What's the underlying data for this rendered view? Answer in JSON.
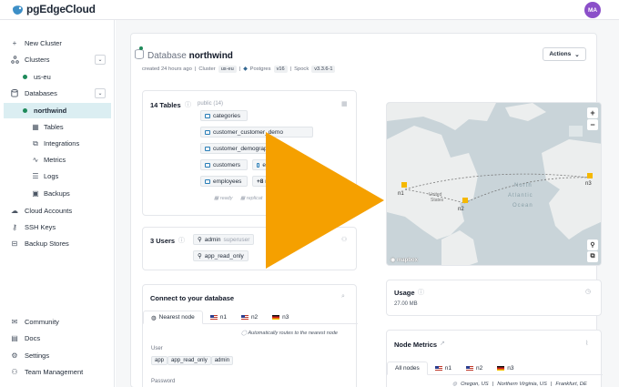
{
  "brand": {
    "name": "pgEdgeCloud"
  },
  "user": {
    "initials": "MA"
  },
  "sidebar": {
    "new_cluster": "New Cluster",
    "clusters": "Clusters",
    "cluster_item": "us-eu",
    "databases": "Databases",
    "database_item": "northwind",
    "sub": [
      "Tables",
      "Integrations",
      "Metrics",
      "Logs",
      "Backups"
    ],
    "cloud_accounts": "Cloud Accounts",
    "ssh_keys": "SSH Keys",
    "backup_stores": "Backup Stores",
    "bottom": [
      "Community",
      "Docs",
      "Settings",
      "Team Management"
    ]
  },
  "header": {
    "prefix": "Database",
    "name": "northwind",
    "actions": "Actions",
    "created": "created 24 hours ago",
    "cluster_label": "Cluster",
    "cluster_value": "us-eu",
    "postgres_label": "Postgres",
    "postgres_version": "v16",
    "spock_label": "Spock",
    "spock_version": "v3.3.6-1"
  },
  "tables_card": {
    "title": "14 Tables",
    "schema": "public (14)",
    "tables": [
      "categories",
      "customer_customer_demo",
      "customer_demograp",
      "customers",
      "e",
      "employees"
    ],
    "more": "+8 m",
    "footer_ready": "ready",
    "footer_replicating": "replicat"
  },
  "users_card": {
    "title": "3 Users",
    "users": [
      {
        "name": "admin",
        "role": "superuser"
      },
      {
        "name": "app_read_only",
        "role": ""
      }
    ]
  },
  "connect_card": {
    "title": "Connect to your database",
    "tabs": [
      "Nearest node",
      "n1",
      "n2",
      "n3"
    ],
    "routing_note": "Automatically routes to the nearest node",
    "user_label": "User",
    "user_options": [
      "app",
      "app_read_only",
      "admin"
    ],
    "password_label": "Password"
  },
  "map": {
    "labels": [
      "North",
      "Atlantic",
      "Ocean",
      "United",
      "States"
    ],
    "nodes": [
      "n1",
      "n2",
      "n3"
    ],
    "attribution": "mapbox"
  },
  "usage_card": {
    "title": "Usage",
    "value": "27.00 MB"
  },
  "metrics_card": {
    "title": "Node Metrics",
    "tabs": [
      "All nodes",
      "n1",
      "n2",
      "n3"
    ],
    "regions": [
      "Oregon, US",
      "Northern Virginia, US",
      "Frankfurt, DE"
    ]
  },
  "colors": {
    "accent": "#1e8a5a",
    "active_bg": "#dbeef2",
    "play": "#f5a000",
    "avatar": "#8b4fc9"
  }
}
